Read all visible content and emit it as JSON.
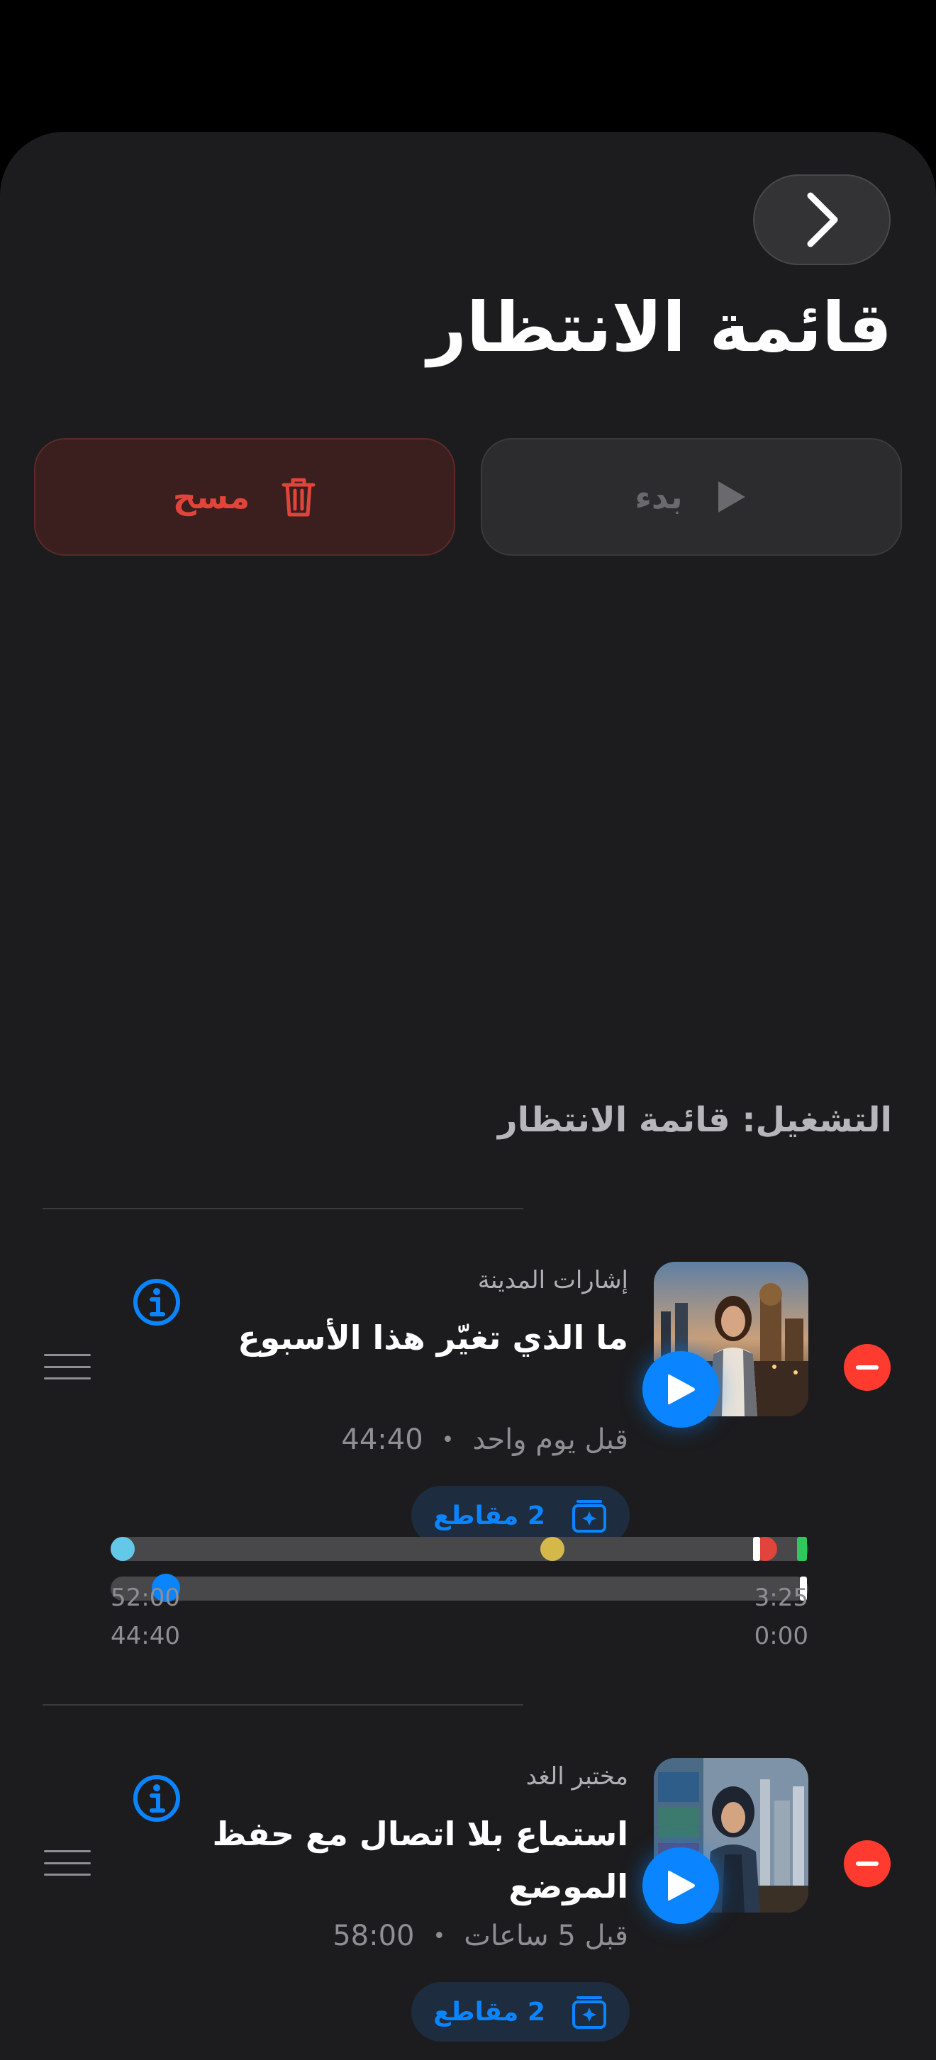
{
  "header": {
    "back_icon": "chevron-right-icon",
    "title": "قائمة الانتظار"
  },
  "actions": {
    "clear_label": "مسح",
    "clear_icon": "trash-icon",
    "start_label": "بدء",
    "start_icon": "play-icon"
  },
  "section": {
    "title": "التشغيل: قائمة الانتظار"
  },
  "episodes": [
    {
      "podcast": "إشارات المدينة",
      "title": "ما الذي تغيّر هذا الأسبوع",
      "published": "قبل يوم واحد",
      "separator": "•",
      "duration": "44:40",
      "clips_label": "2 مقاطع",
      "timeline": {
        "top_left": "52:00",
        "top_right": "3:25",
        "bottom_left": "44:40",
        "bottom_right": "0:00"
      }
    },
    {
      "podcast": "مختبر الغد",
      "title": "استماع بلا اتصال مع حفظ الموضع",
      "published": "قبل 5 ساعات",
      "separator": "•",
      "duration": "58:00",
      "clips_label": "2 مقاطع"
    }
  ],
  "colors": {
    "accent": "#0a84ff",
    "destructive": "#ff3b30",
    "background": "#1c1c1e"
  }
}
